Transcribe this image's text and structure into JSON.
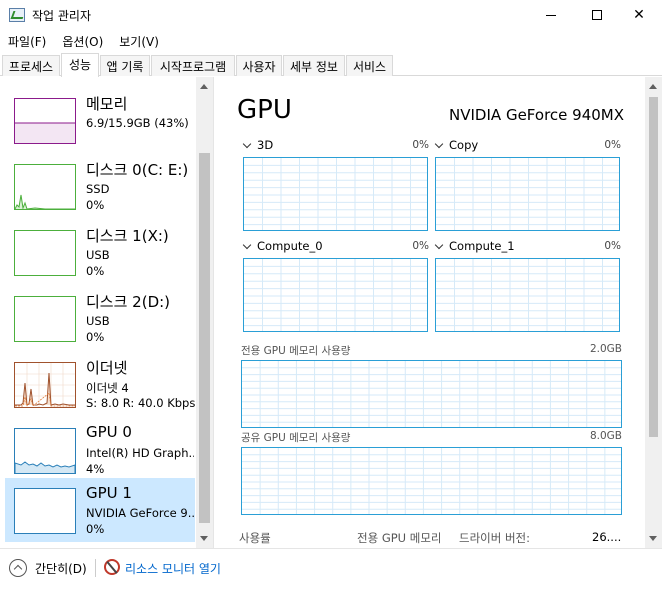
{
  "window": {
    "title": "작업 관리자",
    "icon": "task-manager-icon"
  },
  "menu": [
    "파일(F)",
    "옵션(O)",
    "보기(V)"
  ],
  "tabs": [
    {
      "label": "프로세스",
      "active": false
    },
    {
      "label": "성능",
      "active": true
    },
    {
      "label": "앱 기록",
      "active": false
    },
    {
      "label": "시작프로그램",
      "active": false
    },
    {
      "label": "사용자",
      "active": false
    },
    {
      "label": "세부 정보",
      "active": false
    },
    {
      "label": "서비스",
      "active": false
    }
  ],
  "resources": [
    {
      "name": "메모리",
      "sub1": "6.9/15.9GB (43%)",
      "sub2": "",
      "color": "#8b1a8b",
      "selected": false
    },
    {
      "name": "디스크 0(C: E:)",
      "sub1": "SSD",
      "sub2": "0%",
      "color": "#4caf3c",
      "selected": false
    },
    {
      "name": "디스크 1(X:)",
      "sub1": "USB",
      "sub2": "0%",
      "color": "#4caf3c",
      "selected": false
    },
    {
      "name": "디스크 2(D:)",
      "sub1": "USB",
      "sub2": "0%",
      "color": "#4caf3c",
      "selected": false
    },
    {
      "name": "이더넷",
      "sub1": "이더넷 4",
      "sub2": "S: 8.0  R: 40.0 Kbps",
      "color": "#a0522d",
      "selected": false
    },
    {
      "name": "GPU 0",
      "sub1": "Intel(R) HD Graph...",
      "sub2": "4%",
      "color": "#2a7fb8",
      "selected": false
    },
    {
      "name": "GPU 1",
      "sub1": "NVIDIA GeForce 9...",
      "sub2": "0%",
      "color": "#2a7fb8",
      "selected": true
    }
  ],
  "detail": {
    "title": "GPU",
    "model": "NVIDIA GeForce 940MX",
    "engines": [
      {
        "label": "3D",
        "pct": "0%"
      },
      {
        "label": "Copy",
        "pct": "0%"
      },
      {
        "label": "Compute_0",
        "pct": "0%"
      },
      {
        "label": "Compute_1",
        "pct": "0%"
      }
    ],
    "dedicated_label": "전용 GPU 메모리 사용량",
    "dedicated_max": "2.0GB",
    "shared_label": "공유 GPU 메모리 사용량",
    "shared_max": "8.0GB",
    "stats": {
      "usage": "사용률",
      "dedicated_mem": "전용 GPU 메모리",
      "driver_version": "드라이버 버전:",
      "driver_value": "26...."
    }
  },
  "bottom": {
    "collapse": "간단히(D)",
    "resource_monitor": "리소스 모니터 열기"
  },
  "colors": {
    "graph_border": "#2a9fd6",
    "grid": "#d6eaf8",
    "selected_bg": "#cce8ff",
    "link": "#0066cc"
  }
}
